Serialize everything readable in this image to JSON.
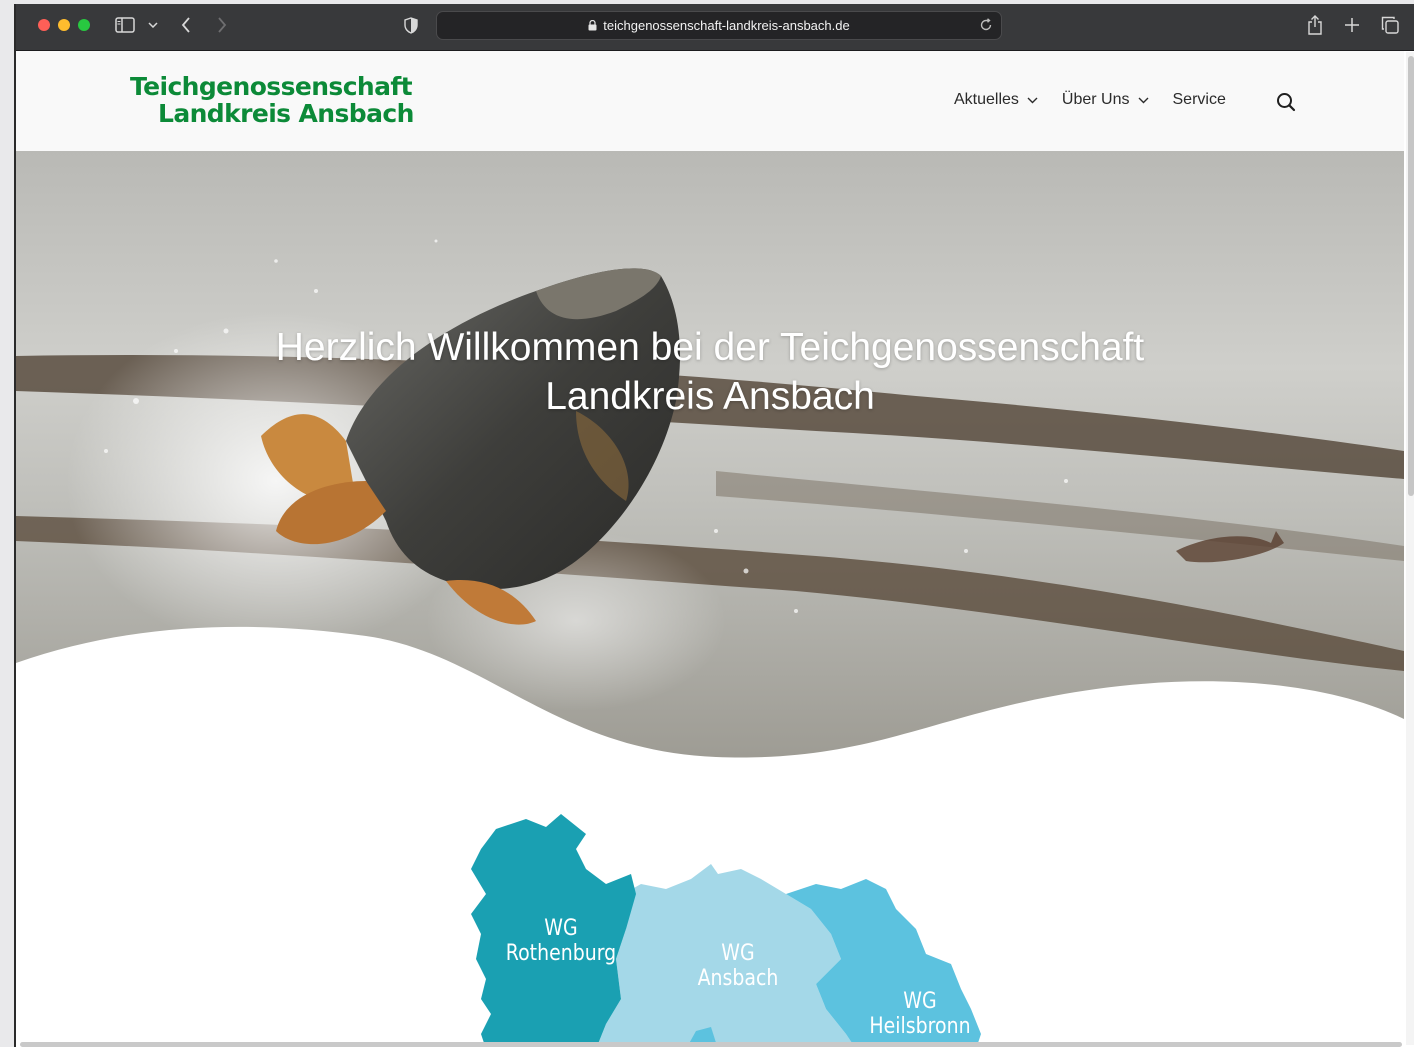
{
  "browser": {
    "url": "teichgenossenschaft-landkreis-ansbach.de"
  },
  "site": {
    "logo_line1": "Teichgenossenschaft",
    "logo_line2": "Landkreis Ansbach",
    "nav": [
      {
        "label": "Aktuelles",
        "has_dropdown": true
      },
      {
        "label": "Über Uns",
        "has_dropdown": true
      },
      {
        "label": "Service",
        "has_dropdown": false
      }
    ],
    "accent_color": "#0c8a38"
  },
  "hero": {
    "title_line1": "Herzlich Willkommen bei der Teichgenossenschaft",
    "title_line2": "Landkreis Ansbach"
  },
  "map": {
    "regions": [
      {
        "line1": "WG",
        "line2": "Rothenburg",
        "color": "#1aa0b2"
      },
      {
        "line1": "WG",
        "line2": "Ansbach",
        "color": "#a4d8e8"
      },
      {
        "line1": "WG",
        "line2": "Heilsbronn",
        "color": "#5cc2df"
      }
    ]
  }
}
